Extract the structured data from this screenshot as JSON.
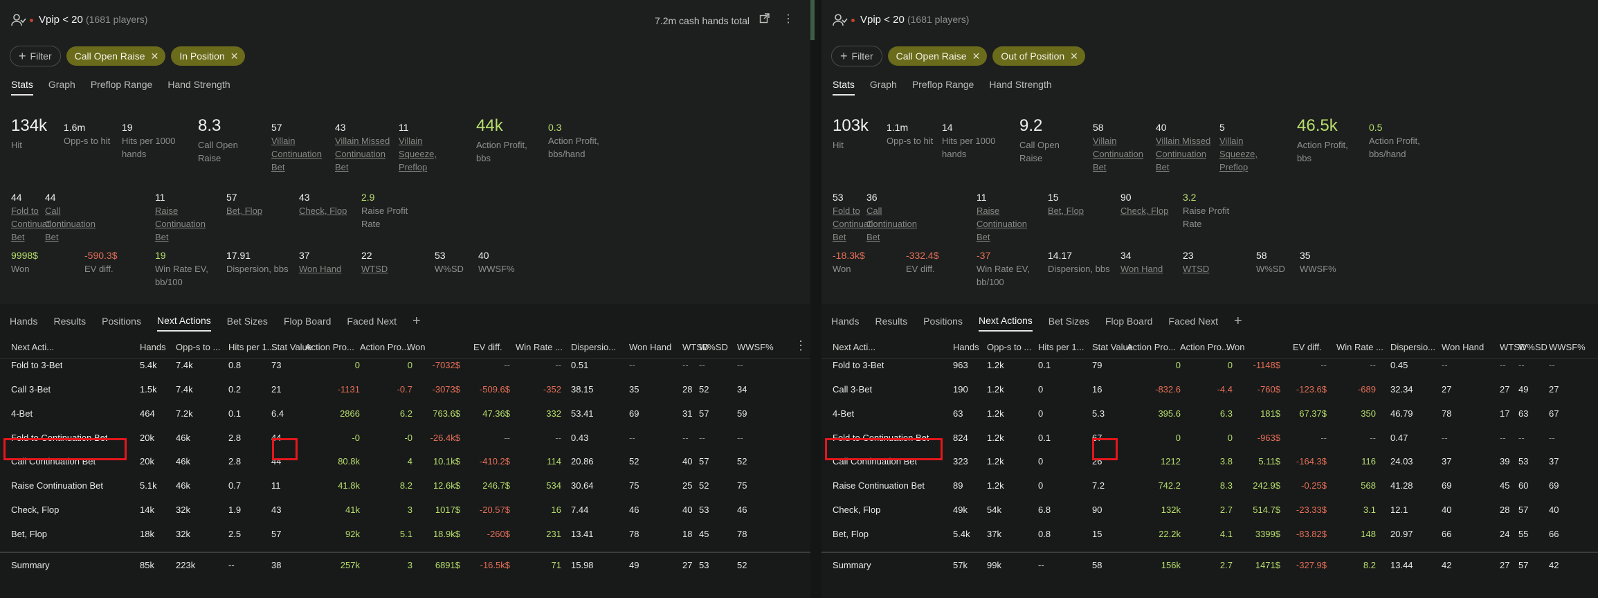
{
  "left": {
    "title": "Vpip < 20",
    "players": "(1681 players)",
    "total": "7.2m cash hands total",
    "filter_label": "Filter",
    "chips": [
      "Call Open Raise",
      "In Position"
    ],
    "stat_tabs": [
      "Stats",
      "Graph",
      "Preflop Range",
      "Hand Strength"
    ],
    "row1": [
      {
        "value": "134k",
        "label": "Hit",
        "kind": "big"
      },
      {
        "value": "1.6m",
        "label": "Opp-s to hit",
        "kind": "mid"
      },
      {
        "value": "19",
        "label": "Hits per 1000 hands",
        "kind": "mid"
      },
      {
        "value": "8.3",
        "label": "Call Open Raise",
        "kind": "big"
      },
      {
        "value": "57",
        "label": "Villain Continuation Bet",
        "kind": "mid",
        "u": true
      },
      {
        "value": "43",
        "label": "Villain Missed Continuation Bet",
        "kind": "mid",
        "u": true
      },
      {
        "value": "11",
        "label": "Villain Squeeze, Preflop",
        "kind": "mid",
        "u": true
      },
      {
        "value": "44k",
        "label": "Action Profit, bbs",
        "kind": "big",
        "color": "green"
      },
      {
        "value": "0.3",
        "label": "Action Profit, bbs/hand",
        "kind": "mid",
        "color": "green"
      }
    ],
    "row2": [
      {
        "value": "44",
        "label": "Fold to Continuation Bet",
        "u": true
      },
      {
        "value": "44",
        "label": "Call Continuation Bet",
        "u": true
      },
      {
        "value": "11",
        "label": "Raise Continuation Bet",
        "u": true
      },
      {
        "value": "57",
        "label": "Bet, Flop",
        "u": true
      },
      {
        "value": "43",
        "label": "Check, Flop",
        "u": true
      },
      {
        "value": "2.9",
        "label": "Raise Profit Rate",
        "color": "green"
      }
    ],
    "row3": [
      {
        "value": "9998$",
        "label": "Won",
        "color": "green"
      },
      {
        "value": "-590.3$",
        "label": "EV diff.",
        "color": "red"
      },
      {
        "value": "19",
        "label": "Win Rate EV, bb/100",
        "color": "green"
      },
      {
        "value": "17.91",
        "label": "Dispersion, bbs"
      },
      {
        "value": "37",
        "label": "Won Hand",
        "u": true
      },
      {
        "value": "22",
        "label": "WTSD",
        "u": true
      },
      {
        "value": "53",
        "label": "W%SD"
      },
      {
        "value": "40",
        "label": "WWSF%"
      }
    ],
    "bottom_tabs": [
      "Hands",
      "Results",
      "Positions",
      "Next Actions",
      "Bet Sizes",
      "Flop Board",
      "Faced Next"
    ],
    "add_tab": "+",
    "columns": [
      "Next Acti...",
      "Hands",
      "Opp-s to ...",
      "Hits per 1...",
      "Stat Value",
      "Action Pro...",
      "Action Pro...",
      "Won",
      "EV diff.",
      "Win Rate ...",
      "Dispersio...",
      "Won Hand",
      "WTSD",
      "W%SD",
      "WWSF%"
    ],
    "rows": [
      [
        "Fold to 3-Bet",
        "5.4k",
        "7.4k",
        "0.8",
        "73",
        "0",
        "0",
        "-7032$",
        "--",
        "--",
        "0.51",
        "--",
        "--",
        "--",
        "--"
      ],
      [
        "Call 3-Bet",
        "1.5k",
        "7.4k",
        "0.2",
        "21",
        "-1131",
        "-0.7",
        "-3073$",
        "-509.6$",
        "-352",
        "38.15",
        "35",
        "28",
        "52",
        "34"
      ],
      [
        "4-Bet",
        "464",
        "7.2k",
        "0.1",
        "6.4",
        "2866",
        "6.2",
        "763.6$",
        "47.36$",
        "332",
        "53.41",
        "69",
        "31",
        "57",
        "59"
      ],
      [
        "Fold to Continuation Bet",
        "20k",
        "46k",
        "2.8",
        "44",
        "-0",
        "-0",
        "-26.4k$",
        "--",
        "--",
        "0.43",
        "--",
        "--",
        "--",
        "--"
      ],
      [
        "Call Continuation Bet",
        "20k",
        "46k",
        "2.8",
        "44",
        "80.8k",
        "4",
        "10.1k$",
        "-410.2$",
        "114",
        "20.86",
        "52",
        "40",
        "57",
        "52"
      ],
      [
        "Raise Continuation Bet",
        "5.1k",
        "46k",
        "0.7",
        "11",
        "41.8k",
        "8.2",
        "12.6k$",
        "246.7$",
        "534",
        "30.64",
        "75",
        "25",
        "52",
        "75"
      ],
      [
        "Check, Flop",
        "14k",
        "32k",
        "1.9",
        "43",
        "41k",
        "3",
        "1017$",
        "-20.57$",
        "16",
        "7.44",
        "46",
        "40",
        "53",
        "46"
      ],
      [
        "Bet, Flop",
        "18k",
        "32k",
        "2.5",
        "57",
        "92k",
        "5.1",
        "18.9k$",
        "-260$",
        "231",
        "13.41",
        "78",
        "18",
        "45",
        "78"
      ]
    ],
    "summary": [
      "Summary",
      "85k",
      "223k",
      "--",
      "38",
      "257k",
      "3",
      "6891$",
      "-16.5k$",
      "71",
      "15.98",
      "49",
      "27",
      "53",
      "52"
    ]
  },
  "right": {
    "title": "Vpip < 20",
    "players": "(1681 players)",
    "filter_label": "Filter",
    "chips": [
      "Call Open Raise",
      "Out of Position"
    ],
    "stat_tabs": [
      "Stats",
      "Graph",
      "Preflop Range",
      "Hand Strength"
    ],
    "row1": [
      {
        "value": "103k",
        "label": "Hit",
        "kind": "big"
      },
      {
        "value": "1.1m",
        "label": "Opp-s to hit",
        "kind": "mid"
      },
      {
        "value": "14",
        "label": "Hits per 1000 hands",
        "kind": "mid"
      },
      {
        "value": "9.2",
        "label": "Call Open Raise",
        "kind": "big"
      },
      {
        "value": "58",
        "label": "Villain Continuation Bet",
        "kind": "mid",
        "u": true
      },
      {
        "value": "40",
        "label": "Villain Missed Continuation Bet",
        "kind": "mid",
        "u": true
      },
      {
        "value": "5",
        "label": "Villain Squeeze, Preflop",
        "kind": "mid",
        "u": true
      },
      {
        "value": "46.5k",
        "label": "Action Profit, bbs",
        "kind": "big",
        "color": "green"
      },
      {
        "value": "0.5",
        "label": "Action Profit, bbs/hand",
        "kind": "mid",
        "color": "green"
      }
    ],
    "row2": [
      {
        "value": "53",
        "label": "Fold to Continuation Bet",
        "u": true
      },
      {
        "value": "36",
        "label": "Call Continuation Bet",
        "u": true
      },
      {
        "value": "11",
        "label": "Raise Continuation Bet",
        "u": true
      },
      {
        "value": "15",
        "label": "Bet, Flop",
        "u": true
      },
      {
        "value": "90",
        "label": "Check, Flop",
        "u": true
      },
      {
        "value": "3.2",
        "label": "Raise Profit Rate",
        "color": "green"
      }
    ],
    "row3": [
      {
        "value": "-18.3k$",
        "label": "Won",
        "color": "red"
      },
      {
        "value": "-332.4$",
        "label": "EV diff.",
        "color": "red"
      },
      {
        "value": "-37",
        "label": "Win Rate EV, bb/100",
        "color": "red"
      },
      {
        "value": "14.17",
        "label": "Dispersion, bbs"
      },
      {
        "value": "34",
        "label": "Won Hand",
        "u": true
      },
      {
        "value": "23",
        "label": "WTSD",
        "u": true
      },
      {
        "value": "58",
        "label": "W%SD"
      },
      {
        "value": "35",
        "label": "WWSF%"
      }
    ],
    "bottom_tabs": [
      "Hands",
      "Results",
      "Positions",
      "Next Actions",
      "Bet Sizes",
      "Flop Board",
      "Faced Next"
    ],
    "add_tab": "+",
    "columns": [
      "Next Acti...",
      "Hands",
      "Opp-s to ...",
      "Hits per 1...",
      "Stat Value",
      "Action Pro...",
      "Action Pro...",
      "Won",
      "EV diff.",
      "Win Rate ...",
      "Dispersio...",
      "Won Hand",
      "WTSD",
      "W%SD",
      "WWSF%"
    ],
    "rows": [
      [
        "Fold to 3-Bet",
        "963",
        "1.2k",
        "0.1",
        "79",
        "0",
        "0",
        "-1148$",
        "--",
        "--",
        "0.45",
        "--",
        "--",
        "--",
        "--"
      ],
      [
        "Call 3-Bet",
        "190",
        "1.2k",
        "0",
        "16",
        "-832.6",
        "-4.4",
        "-760$",
        "-123.6$",
        "-689",
        "32.34",
        "27",
        "27",
        "49",
        "27"
      ],
      [
        "4-Bet",
        "63",
        "1.2k",
        "0",
        "5.3",
        "395.6",
        "6.3",
        "181$",
        "67.37$",
        "350",
        "46.79",
        "78",
        "17",
        "63",
        "67"
      ],
      [
        "Fold to Continuation Bet",
        "824",
        "1.2k",
        "0.1",
        "67",
        "0",
        "0",
        "-963$",
        "--",
        "--",
        "0.47",
        "--",
        "--",
        "--",
        "--"
      ],
      [
        "Call Continuation Bet",
        "323",
        "1.2k",
        "0",
        "26",
        "1212",
        "3.8",
        "5.11$",
        "-164.3$",
        "116",
        "24.03",
        "37",
        "39",
        "53",
        "37"
      ],
      [
        "Raise Continuation Bet",
        "89",
        "1.2k",
        "0",
        "7.2",
        "742.2",
        "8.3",
        "242.9$",
        "-0.25$",
        "568",
        "41.28",
        "69",
        "45",
        "60",
        "69"
      ],
      [
        "Check, Flop",
        "49k",
        "54k",
        "6.8",
        "90",
        "132k",
        "2.7",
        "514.7$",
        "-23.33$",
        "3.1",
        "12.1",
        "40",
        "28",
        "57",
        "40"
      ],
      [
        "Bet, Flop",
        "5.4k",
        "37k",
        "0.8",
        "15",
        "22.2k",
        "4.1",
        "3399$",
        "-83.82$",
        "148",
        "20.97",
        "66",
        "24",
        "55",
        "66"
      ]
    ],
    "summary": [
      "Summary",
      "57k",
      "99k",
      "--",
      "58",
      "156k",
      "2.7",
      "1471$",
      "-327.9$",
      "8.2",
      "13.44",
      "42",
      "27",
      "57",
      "42"
    ]
  }
}
